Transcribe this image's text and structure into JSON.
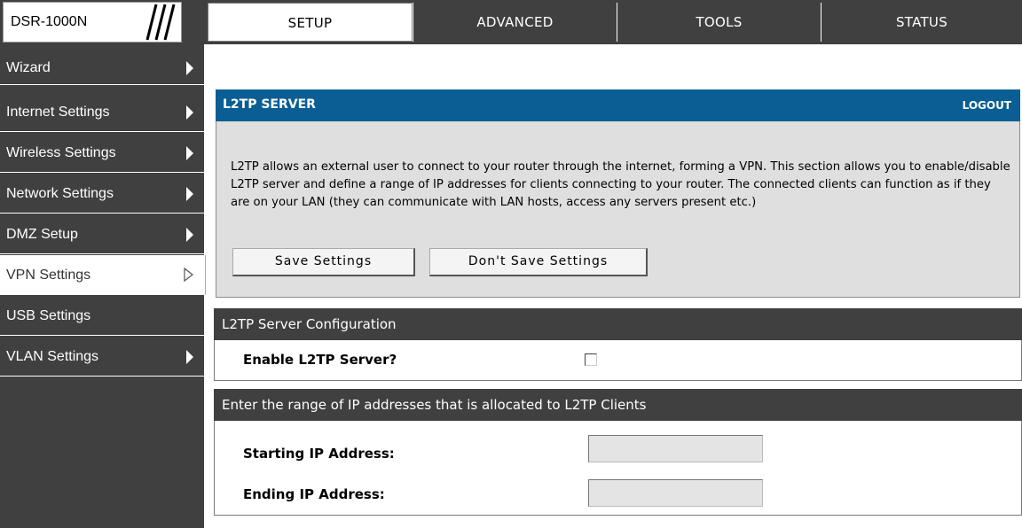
{
  "header": {
    "device_model": "DSR-1000N",
    "tabs": [
      {
        "label": "SETUP",
        "active": true
      },
      {
        "label": "ADVANCED",
        "active": false
      },
      {
        "label": "TOOLS",
        "active": false
      },
      {
        "label": "STATUS",
        "active": false
      }
    ]
  },
  "sidebar": {
    "items": [
      {
        "label": "Wizard",
        "arrow": "filled"
      },
      {
        "label": "Internet Settings",
        "arrow": "filled"
      },
      {
        "label": "Wireless Settings",
        "arrow": "filled"
      },
      {
        "label": "Network Settings",
        "arrow": "filled"
      },
      {
        "label": "DMZ Setup",
        "arrow": "filled"
      },
      {
        "label": "VPN Settings",
        "arrow": "hollow",
        "active": true
      },
      {
        "label": "USB Settings",
        "arrow": "none"
      },
      {
        "label": "VLAN Settings",
        "arrow": "filled"
      }
    ]
  },
  "panel": {
    "title": "L2TP SERVER",
    "logout": "LOGOUT",
    "description": "L2TP allows an external user to connect to your router through the internet, forming a VPN. This section allows you to enable/disable L2TP server and define a range of IP addresses for clients connecting to your router. The connected clients can function as if they are on your LAN (they can communicate with LAN hosts, access any servers present etc.)",
    "save_button": "Save Settings",
    "dont_save_button": "Don't Save Settings"
  },
  "config_section": {
    "title": "L2TP Server Configuration",
    "enable_label": "Enable L2TP Server?",
    "enable_checked": false
  },
  "ip_section": {
    "title": "Enter the range of IP addresses that is allocated to L2TP Clients",
    "start_label": "Starting IP Address:",
    "start_value": "",
    "end_label": "Ending IP Address:",
    "end_value": ""
  },
  "colors": {
    "panel_header": "#0b5e93",
    "dark_bar": "#404040",
    "panel_body": "#dfdfdf"
  }
}
